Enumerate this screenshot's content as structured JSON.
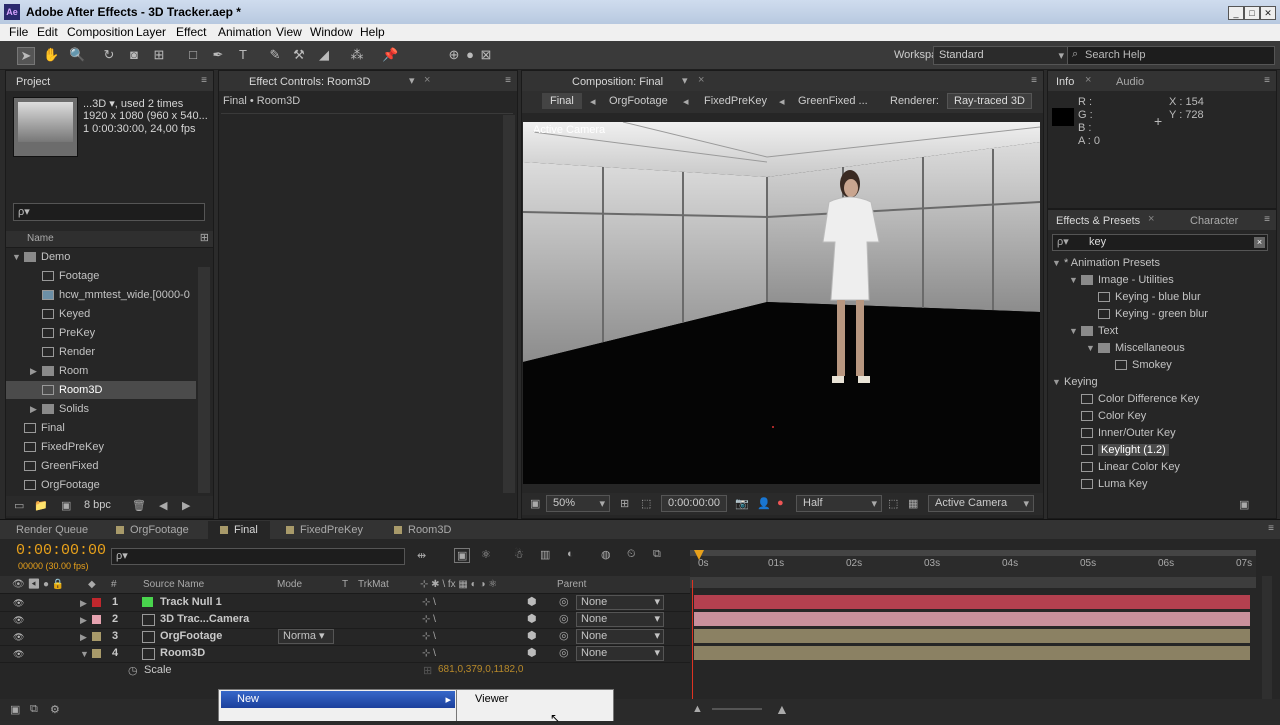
{
  "window": {
    "title": "Adobe After Effects - 3D Tracker.aep *",
    "app_icon": "Ae"
  },
  "menu": [
    "File",
    "Edit",
    "Composition",
    "Layer",
    "Effect",
    "Animation",
    "View",
    "Window",
    "Help"
  ],
  "toolbar": {
    "workspace_label": "Workspace:",
    "workspace_value": "Standard",
    "search_placeholder": "Search Help"
  },
  "project": {
    "tab": "Project",
    "item_name": "...3D ▾, used 2 times",
    "item_dims": "1920 x 1080  (960 x 540...",
    "item_duration": "1 0:00:30:00, 24,00 fps",
    "search_placeholder": "ρ▾",
    "col_name": "Name",
    "items": [
      {
        "label": "Demo",
        "type": "folder",
        "indent": 0,
        "twirl": "▼"
      },
      {
        "label": "Footage",
        "type": "comp",
        "indent": 1,
        "twirl": ""
      },
      {
        "label": "hcw_mmtest_wide.[0000-0",
        "type": "footage",
        "indent": 1,
        "twirl": ""
      },
      {
        "label": "Keyed",
        "type": "comp",
        "indent": 1,
        "twirl": ""
      },
      {
        "label": "PreKey",
        "type": "comp",
        "indent": 1,
        "twirl": ""
      },
      {
        "label": "Render",
        "type": "comp",
        "indent": 1,
        "twirl": ""
      },
      {
        "label": "Room",
        "type": "folder",
        "indent": 1,
        "twirl": "▶"
      },
      {
        "label": "Room3D",
        "type": "comp",
        "indent": 1,
        "twirl": "",
        "selected": true
      },
      {
        "label": "Solids",
        "type": "folder",
        "indent": 1,
        "twirl": "▶"
      },
      {
        "label": "Final",
        "type": "comp",
        "indent": 0,
        "twirl": ""
      },
      {
        "label": "FixedPreKey",
        "type": "comp",
        "indent": 0,
        "twirl": ""
      },
      {
        "label": "GreenFixed",
        "type": "comp",
        "indent": 0,
        "twirl": ""
      },
      {
        "label": "OrgFootage",
        "type": "comp",
        "indent": 0,
        "twirl": ""
      }
    ],
    "bpc": "8 bpc"
  },
  "effect_controls": {
    "tab": "Effect Controls: Room3D",
    "breadcrumb": "Final • Room3D"
  },
  "composition": {
    "tab": "Composition: Final",
    "breadcrumbs": [
      "Final",
      "OrgFootage",
      "FixedPreKey",
      "GreenFixed ..."
    ],
    "renderer_label": "Renderer:",
    "renderer_value": "Ray-traced 3D",
    "viewport_label": "Active Camera",
    "zoom": "50%",
    "timecode": "0:00:00:00",
    "resolution": "Half",
    "view": "Active Camera"
  },
  "info": {
    "tab_info": "Info",
    "tab_audio": "Audio",
    "r": "R :",
    "g": "G :",
    "b": "B :",
    "a": "A : 0",
    "x": "X : 154",
    "y": "Y : 728"
  },
  "effects_presets": {
    "tab": "Effects & Presets",
    "tab2": "Character",
    "search_value": "key",
    "items": [
      {
        "label": "* Animation Presets",
        "indent": 0,
        "twirl": "▼",
        "type": "none"
      },
      {
        "label": "Image - Utilities",
        "indent": 1,
        "twirl": "▼",
        "type": "folder"
      },
      {
        "label": "Keying - blue blur",
        "indent": 2,
        "twirl": "",
        "type": "preset"
      },
      {
        "label": "Keying - green blur",
        "indent": 2,
        "twirl": "",
        "type": "preset"
      },
      {
        "label": "Text",
        "indent": 1,
        "twirl": "▼",
        "type": "folder"
      },
      {
        "label": "Miscellaneous",
        "indent": 2,
        "twirl": "▼",
        "type": "folder"
      },
      {
        "label": "Smokey",
        "indent": 3,
        "twirl": "",
        "type": "preset"
      },
      {
        "label": "Keying",
        "indent": 0,
        "twirl": "▼",
        "type": "none"
      },
      {
        "label": "Color Difference Key",
        "indent": 1,
        "twirl": "",
        "type": "effect"
      },
      {
        "label": "Color Key",
        "indent": 1,
        "twirl": "",
        "type": "effect"
      },
      {
        "label": "Inner/Outer Key",
        "indent": 1,
        "twirl": "",
        "type": "effect"
      },
      {
        "label": "Keylight (1.2)",
        "indent": 1,
        "twirl": "",
        "type": "effect",
        "selected": true
      },
      {
        "label": "Linear Color Key",
        "indent": 1,
        "twirl": "",
        "type": "effect"
      },
      {
        "label": "Luma Key",
        "indent": 1,
        "twirl": "",
        "type": "effect"
      }
    ]
  },
  "timeline": {
    "tabs": [
      {
        "label": "Render Queue",
        "color": ""
      },
      {
        "label": "OrgFootage",
        "color": "#a89a6a"
      },
      {
        "label": "Final",
        "color": "#a89a6a",
        "active": true
      },
      {
        "label": "FixedPreKey",
        "color": "#a89a6a"
      },
      {
        "label": "Room3D",
        "color": "#a89a6a"
      }
    ],
    "timecode": "0:00:00:00",
    "frame_info": "00000 (30.00 fps)",
    "search_placeholder": "ρ▾",
    "col_source": "Source Name",
    "col_mode": "Mode",
    "col_t": "T",
    "col_trkmat": "TrkMat",
    "col_parent": "Parent",
    "ruler": [
      "0s",
      "01s",
      "02s",
      "03s",
      "04s",
      "05s",
      "06s",
      "07s"
    ],
    "layers": [
      {
        "num": "1",
        "name": "Track Null 1",
        "label_color": "#c0272d",
        "icon_color": "#49d44d",
        "mode": "",
        "parent": "None",
        "bar_color": "#b4404f",
        "twirl": "▶"
      },
      {
        "num": "2",
        "name": "3D Trac...Camera",
        "label_color": "#e6a3b0",
        "icon_color": "",
        "mode": "",
        "parent": "None",
        "bar_color": "#c9909c",
        "twirl": "▶"
      },
      {
        "num": "3",
        "name": "OrgFootage",
        "label_color": "#a89a6a",
        "icon_color": "",
        "mode": "Norma ▾",
        "parent": "None",
        "bar_color": "#8b8163",
        "twirl": "▶"
      },
      {
        "num": "4",
        "name": "Room3D",
        "label_color": "#a89a6a",
        "icon_color": "",
        "mode": "",
        "parent": "None",
        "bar_color": "#8b8163",
        "twirl": "▼"
      }
    ],
    "scale_label": "Scale",
    "scale_value": "681,0,379,0,1182,0"
  },
  "context_menu": {
    "item": "New",
    "submenu_item": "Viewer"
  }
}
